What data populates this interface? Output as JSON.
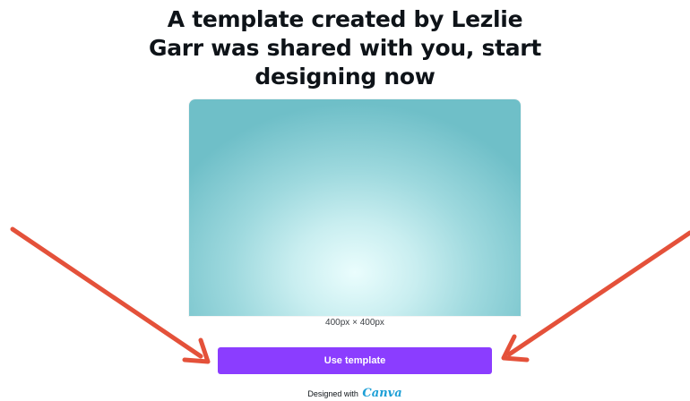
{
  "heading": {
    "line1": "A template created by Lezlie",
    "line2": "Garr was shared with you, start",
    "line3": "designing now"
  },
  "preview": {
    "dimensions": "400px × 400px"
  },
  "actions": {
    "use_template_label": "Use template"
  },
  "footer": {
    "prefix": "Designed with",
    "brand": "Canva"
  },
  "colors": {
    "button": "#8b3dff",
    "arrow": "#e4513a",
    "brand": "#1c9fd6",
    "preview_edge": "#6fbfc8",
    "preview_center": "#eafdfd"
  }
}
